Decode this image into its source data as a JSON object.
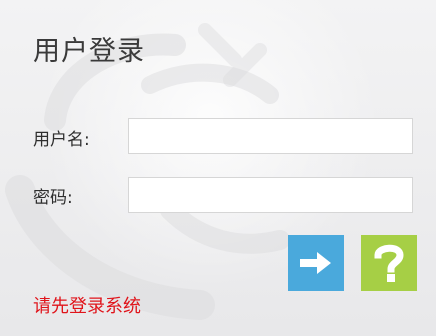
{
  "login": {
    "title": "用户登录",
    "username_label": "用户名:",
    "username_value": "",
    "password_label": "密码:",
    "password_value": "",
    "submit_icon": "arrow-right-icon",
    "help_icon": "question-mark-icon",
    "message": "请先登录系统"
  },
  "colors": {
    "submit_button": "#4aa9dc",
    "help_button": "#a6cf45",
    "message_text": "#e0141b"
  }
}
